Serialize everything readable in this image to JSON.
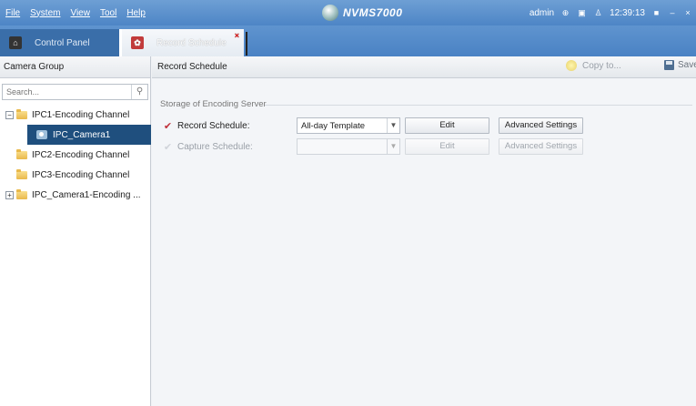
{
  "menubar": {
    "menus": [
      "File",
      "System",
      "View",
      "Tool",
      "Help"
    ],
    "app_title": "NVMS7000",
    "user": "admin",
    "time": "12:39:13"
  },
  "tabs": [
    {
      "label": "Control Panel"
    },
    {
      "label": "Record Schedule",
      "close": "×"
    }
  ],
  "left_panel": {
    "title": "Camera Group",
    "search_placeholder": "Search...",
    "tree": [
      {
        "label": "IPC1-Encoding Channel",
        "expander": "−"
      },
      {
        "label": "IPC_Camera1"
      },
      {
        "label": "IPC2-Encoding Channel"
      },
      {
        "label": "IPC3-Encoding Channel"
      },
      {
        "label": "IPC_Camera1-Encoding ...",
        "expander": "+"
      }
    ]
  },
  "main": {
    "title": "Record Schedule",
    "copy_label": "Copy to...",
    "save_label": "Save",
    "section_title": "Storage of Encoding Server",
    "record": {
      "checked": "✔",
      "label": "Record Schedule:",
      "template": "All-day Template",
      "edit": "Edit",
      "advanced": "Advanced Settings"
    },
    "capture": {
      "checked": "✔",
      "label": "Capture Schedule:",
      "template": "",
      "edit": "Edit",
      "advanced": "Advanced Settings"
    }
  },
  "colors": {
    "menubar": "#5a8fcd",
    "selected_row": "#1f4f7e",
    "check_red": "#c0303a"
  }
}
